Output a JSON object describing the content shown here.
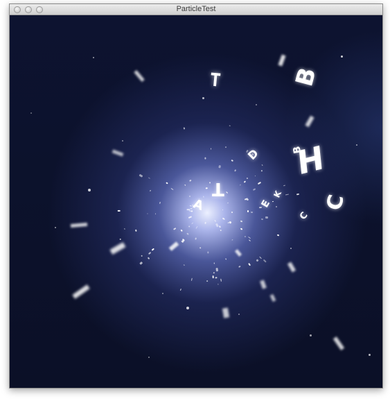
{
  "window": {
    "title": "ParticleTest"
  },
  "traffic_lights": [
    "close-icon",
    "minimize-icon",
    "zoom-icon"
  ],
  "letters": [
    "H",
    "C",
    "B",
    "T",
    "D",
    "E",
    "K",
    "C",
    "B",
    "T",
    "A"
  ],
  "colors": {
    "background": "#0d1330",
    "glow": "#e6ebff",
    "letter": "#ffffff"
  }
}
